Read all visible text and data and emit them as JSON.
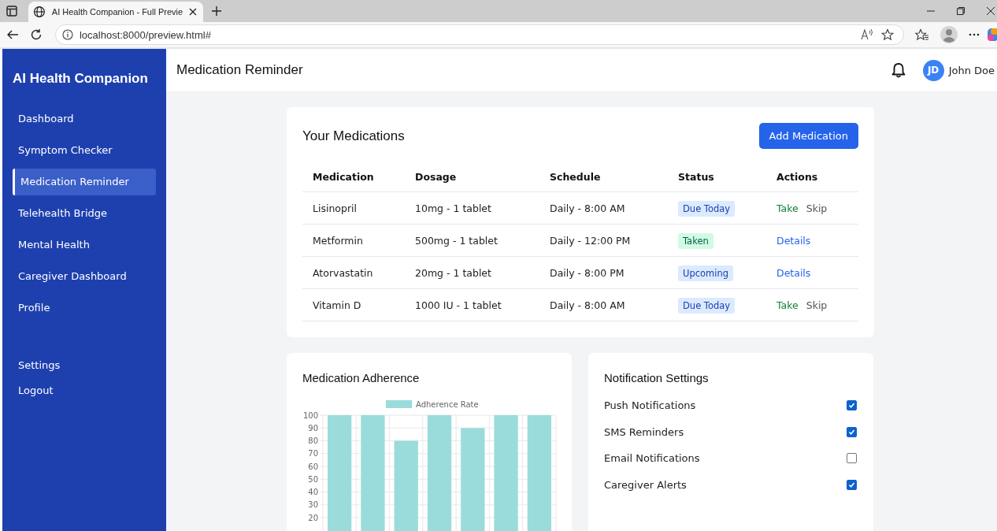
{
  "browser": {
    "tab_title": "AI Health Companion - Full Previe",
    "address": "localhost:8000/preview.html#"
  },
  "sidebar": {
    "brand": "AI Health Companion",
    "items": [
      {
        "label": "Dashboard",
        "selected": false
      },
      {
        "label": "Symptom Checker",
        "selected": false
      },
      {
        "label": "Medication Reminder",
        "selected": true
      },
      {
        "label": "Telehealth Bridge",
        "selected": false
      },
      {
        "label": "Mental Health",
        "selected": false
      },
      {
        "label": "Caregiver Dashboard",
        "selected": false
      },
      {
        "label": "Profile",
        "selected": false
      }
    ],
    "bottom_items": [
      "Settings",
      "Logout"
    ]
  },
  "header": {
    "title": "Medication Reminder",
    "user": {
      "initials": "JD",
      "name": "John Doe"
    }
  },
  "medications": {
    "title": "Your Medications",
    "add_button": "Add Medication",
    "columns": [
      "Medication",
      "Dosage",
      "Schedule",
      "Status",
      "Actions"
    ],
    "rows": [
      {
        "name": "Lisinopril",
        "dosage": "10mg - 1 tablet",
        "schedule": "Daily - 8:00 AM",
        "status": {
          "label": "Due Today",
          "kind": "due"
        },
        "actions": [
          {
            "label": "Take",
            "kind": "take"
          },
          {
            "label": "Skip",
            "kind": "skip"
          }
        ]
      },
      {
        "name": "Metformin",
        "dosage": "500mg - 1 tablet",
        "schedule": "Daily - 12:00 PM",
        "status": {
          "label": "Taken",
          "kind": "taken"
        },
        "actions": [
          {
            "label": "Details",
            "kind": "details"
          }
        ]
      },
      {
        "name": "Atorvastatin",
        "dosage": "20mg - 1 tablet",
        "schedule": "Daily - 8:00 PM",
        "status": {
          "label": "Upcoming",
          "kind": "upcoming"
        },
        "actions": [
          {
            "label": "Details",
            "kind": "details"
          }
        ]
      },
      {
        "name": "Vitamin D",
        "dosage": "1000 IU - 1 tablet",
        "schedule": "Daily - 8:00 AM",
        "status": {
          "label": "Due Today",
          "kind": "due"
        },
        "actions": [
          {
            "label": "Take",
            "kind": "take"
          },
          {
            "label": "Skip",
            "kind": "skip"
          }
        ]
      }
    ]
  },
  "adherence": {
    "title": "Medication Adherence",
    "chart_data": {
      "type": "bar",
      "series": [
        {
          "name": "Adherence Rate",
          "color": "#99dcdb",
          "values": [
            100,
            100,
            80,
            100,
            90,
            100,
            100
          ]
        }
      ],
      "ylim": [
        20,
        100
      ],
      "grid": true,
      "yticks": [
        20,
        30,
        40,
        50,
        60,
        70,
        80,
        90,
        100
      ]
    }
  },
  "notifications": {
    "title": "Notification Settings",
    "items": [
      {
        "label": "Push Notifications",
        "checked": true
      },
      {
        "label": "SMS Reminders",
        "checked": true
      },
      {
        "label": "Email Notifications",
        "checked": false
      },
      {
        "label": "Caregiver Alerts",
        "checked": true
      }
    ]
  }
}
